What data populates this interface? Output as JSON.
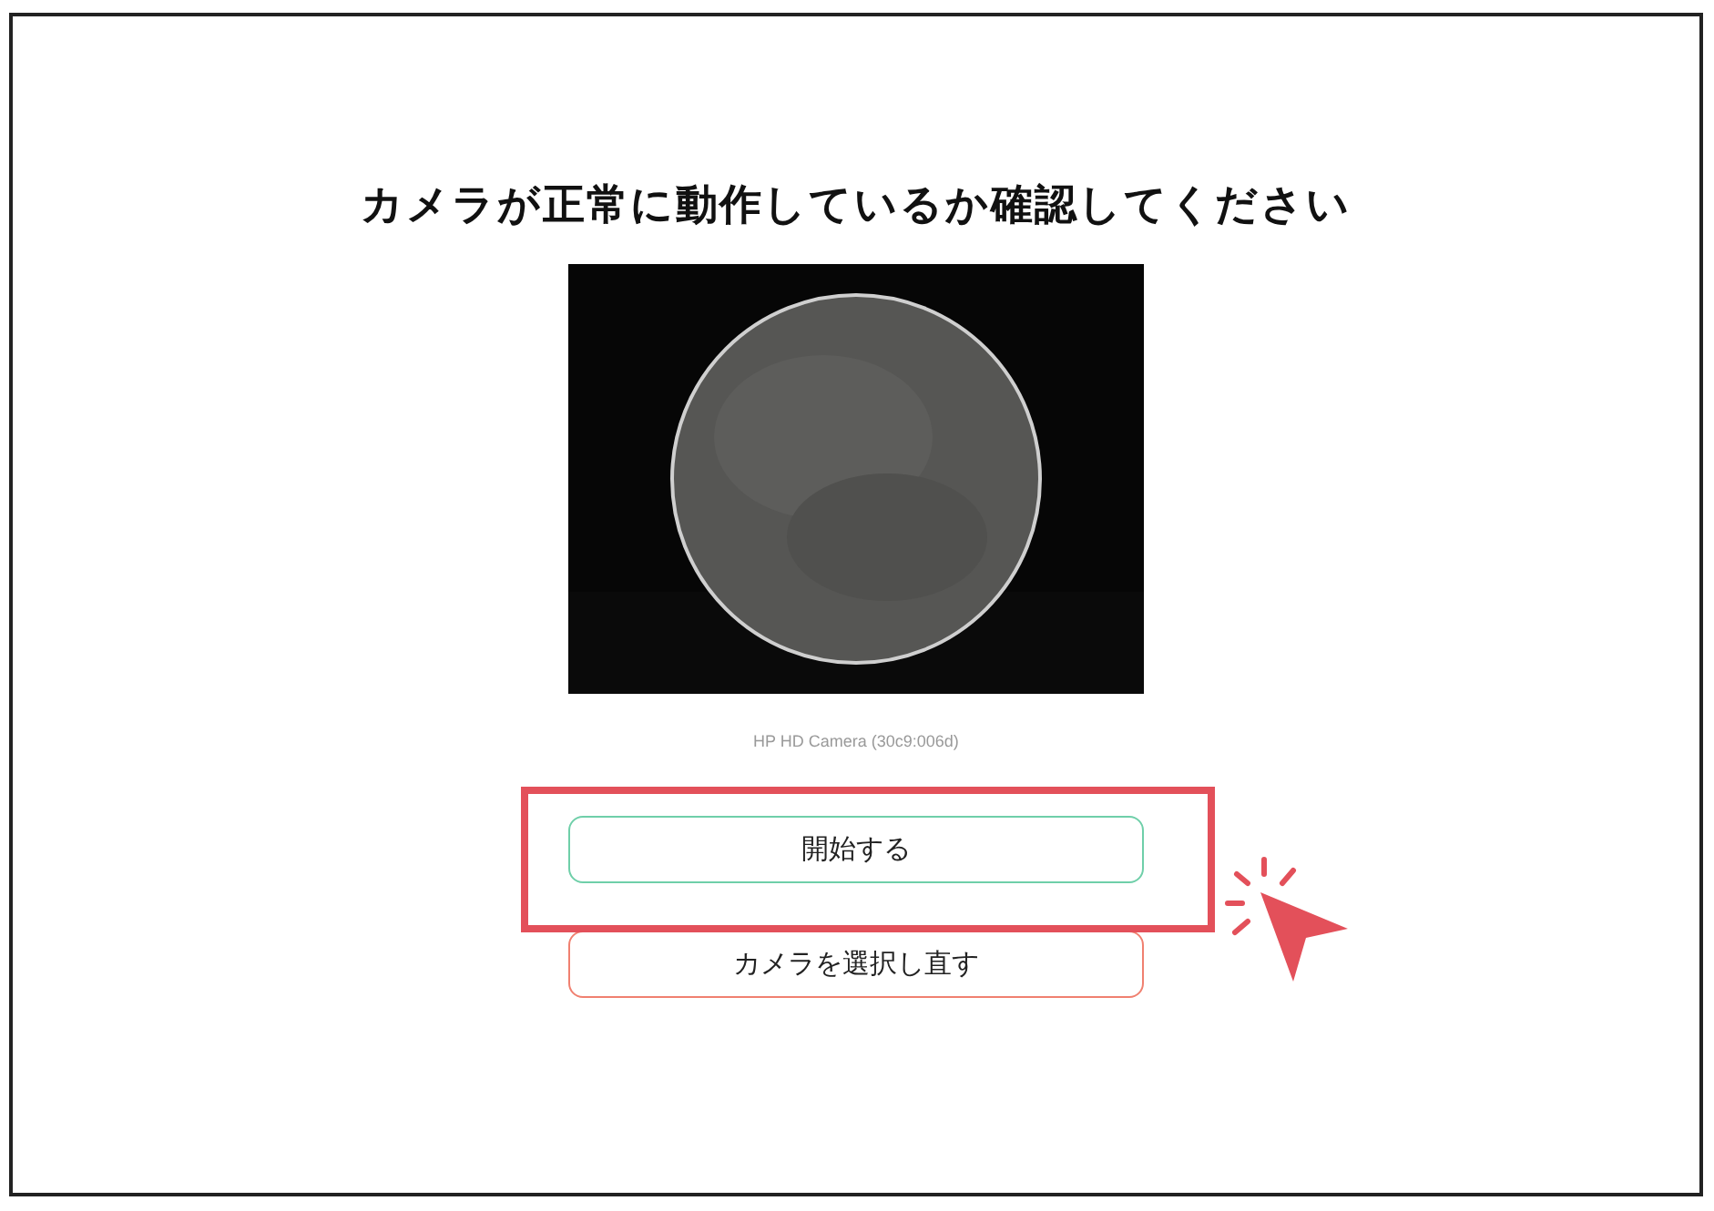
{
  "title": "カメラが正常に動作しているか確認してください",
  "camera": {
    "kind": "picture",
    "device": "HP HD Camera (30c9:006d)"
  },
  "buttons": [
    {
      "label": "開始する",
      "kind": "primary",
      "highlighted": true
    },
    {
      "label": "カメラを選択し直す",
      "kind": "secondary",
      "highlighted": false
    }
  ]
}
